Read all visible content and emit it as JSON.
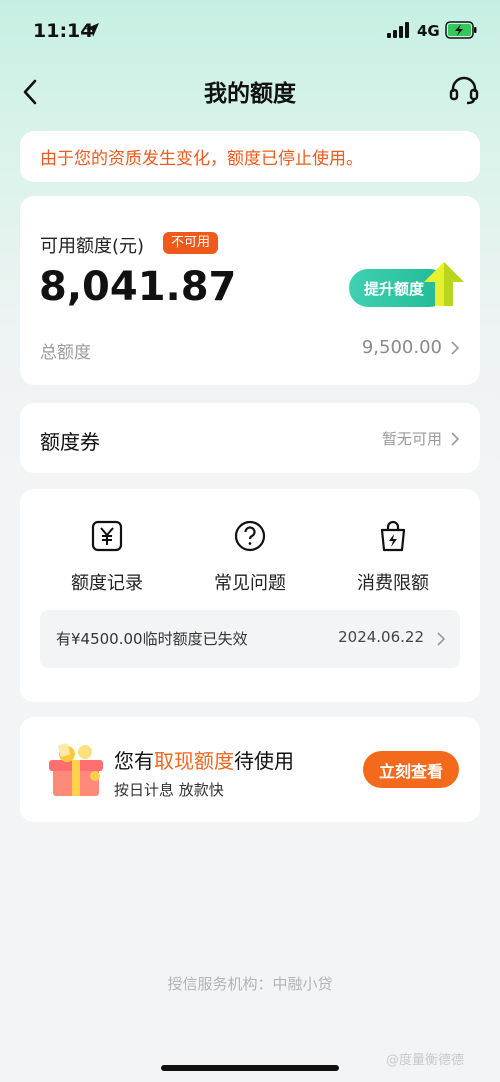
{
  "status_bar": {
    "time": "11:14",
    "network": "4G"
  },
  "nav": {
    "title": "我的额度"
  },
  "warning": {
    "text": "由于您的资质发生变化，额度已停止使用。"
  },
  "quota": {
    "available_label": "可用额度(元)",
    "status_badge": "不可用",
    "available_amount": "8,041.87",
    "raise_button": "提升额度",
    "total_label": "总额度",
    "total_value": "9,500.00"
  },
  "coupon": {
    "title": "额度券",
    "status": "暂无可用"
  },
  "features": {
    "items": [
      {
        "label": "额度记录",
        "icon": "yuan-record-icon"
      },
      {
        "label": "常见问题",
        "icon": "question-icon"
      },
      {
        "label": "消费限额",
        "icon": "bag-bolt-icon"
      }
    ],
    "notice": {
      "text": "有¥4500.00临时额度已失效",
      "date": "2024.06.22"
    }
  },
  "promo": {
    "title_prefix": "您有",
    "title_highlight": "取现额度",
    "title_suffix": "待使用",
    "subtitle": "按日计息 放款快",
    "button": "立刻查看"
  },
  "footer": {
    "text": "授信服务机构：中融小贷"
  },
  "watermark": {
    "text": "@度量衡德德"
  },
  "colors": {
    "accent_orange": "#ef5a1c",
    "accent_green": "#21b995",
    "page_bg": "#f3f4f6"
  }
}
